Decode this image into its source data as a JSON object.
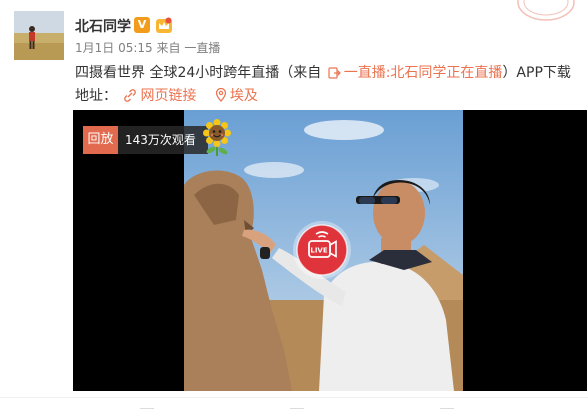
{
  "post": {
    "author": "北石同学",
    "badge": "V",
    "time": "1月1日 05:15",
    "source_prefix": "来自",
    "source": "一直播",
    "text_main": "四摄看世界 全球24小时跨年直播（来自",
    "source_link": "一直播:北石同学正在直播",
    "text_after": "）APP下载",
    "text_line2_label": "地址：",
    "web_link": "网页链接",
    "location": "埃及"
  },
  "video": {
    "replay_label": "回放",
    "views": "143万次观看",
    "live_label": "LIVE"
  },
  "colors": {
    "accent": "#eb7350",
    "replay_badge": "#e26b4f",
    "live_button": "#e0343c",
    "verified": "#f39c1b"
  },
  "icons": [
    "verified-v-icon",
    "crown-badge-icon",
    "link-icon",
    "location-pin-icon",
    "sunflower-icon",
    "live-camera-icon"
  ]
}
